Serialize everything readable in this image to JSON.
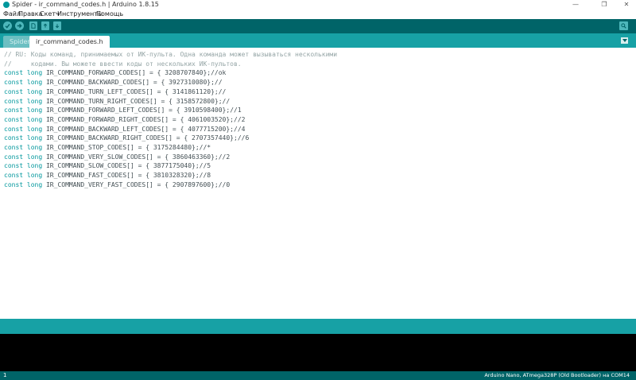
{
  "window": {
    "title": "Spider - ir_command_codes.h | Arduino 1.8.15",
    "minimize": "—",
    "maximize": "❐",
    "close": "✕"
  },
  "menu": [
    "Файл",
    "Правка",
    "Скетч",
    "Инструменты",
    "Помощь"
  ],
  "toolbar": {
    "buttons": [
      "verify-icon",
      "upload-icon",
      "new-icon",
      "open-icon",
      "save-icon"
    ],
    "serial": "serial-monitor-icon"
  },
  "tabs": [
    {
      "label": "Spider",
      "active": false
    },
    {
      "label": "ir_command_codes.h",
      "active": true
    }
  ],
  "code": {
    "comments": [
      "// RU: Коды команд, принимаемых от ИК-пульта. Одна команда может вызываться несколькими",
      "//     кодами. Вы можете ввести коды от нескольких ИК-пультов."
    ],
    "lines": [
      {
        "kw": "const long",
        "decl": " IR_COMMAND_FORWARD_CODES[] = { 3208707840};",
        "cm": "//ok"
      },
      {
        "kw": "const long",
        "decl": " IR_COMMAND_BACKWARD_CODES[] = { 3927310080};",
        "cm": "//"
      },
      {
        "kw": "const long",
        "decl": " IR_COMMAND_TURN_LEFT_CODES[] = { 3141861120};",
        "cm": "//"
      },
      {
        "kw": "const long",
        "decl": " IR_COMMAND_TURN_RIGHT_CODES[] = { 3158572800};",
        "cm": "//"
      },
      {
        "kw": "const long",
        "decl": " IR_COMMAND_FORWARD_LEFT_CODES[] = { 3910598400};",
        "cm": "//1"
      },
      {
        "kw": "const long",
        "decl": " IR_COMMAND_FORWARD_RIGHT_CODES[] = { 4061003520};",
        "cm": "//2"
      },
      {
        "kw": "const long",
        "decl": " IR_COMMAND_BACKWARD_LEFT_CODES[] = { 4077715200};",
        "cm": "//4"
      },
      {
        "kw": "const long",
        "decl": " IR_COMMAND_BACKWARD_RIGHT_CODES[] = { 2707357440};",
        "cm": "//6"
      },
      {
        "kw": "const long",
        "decl": " IR_COMMAND_STOP_CODES[] = { 3175284480};",
        "cm": "//*"
      },
      {
        "kw": "const long",
        "decl": " IR_COMMAND_VERY_SLOW_CODES[] = { 3860463360};",
        "cm": "//2"
      },
      {
        "kw": "const long",
        "decl": " IR_COMMAND_SLOW_CODES[] = { 3877175040};",
        "cm": "//5"
      },
      {
        "kw": "const long",
        "decl": " IR_COMMAND_FAST_CODES[] = { 3810328320};",
        "cm": "//8"
      },
      {
        "kw": "const long",
        "decl": " IR_COMMAND_VERY_FAST_CODES[] = { 2907897600};",
        "cm": "//0"
      }
    ]
  },
  "footer": {
    "line": "1",
    "board": "Arduino Nano, ATmega328P (Old Bootloader) на COM14"
  }
}
